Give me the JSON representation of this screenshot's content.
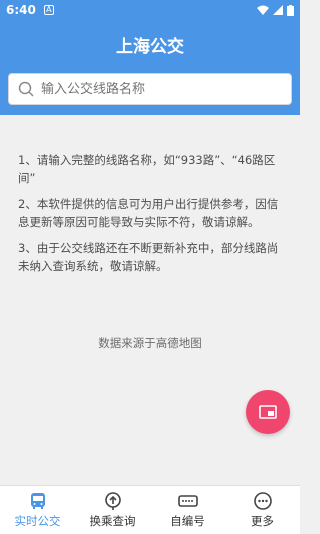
{
  "status_bar": {
    "time": "6:40",
    "notification_icon": "A"
  },
  "header": {
    "title": "上海公交"
  },
  "search": {
    "placeholder": "输入公交线路名称"
  },
  "notes": [
    "1、请输入完整的线路名称，如“933路”、“46路区间”",
    "2、本软件提供的信息可为用户出行提供参考，因信息更新等原因可能导致与实际不符，敬请谅解。",
    "3、由于公交线路还在不断更新补充中，部分线路尚未纳入查询系统，敬请谅解。"
  ],
  "source": "数据来源于高德地图",
  "tabs": [
    {
      "label": "实时公交",
      "icon": "bus-icon",
      "active": true
    },
    {
      "label": "换乘查询",
      "icon": "route-icon",
      "active": false
    },
    {
      "label": "自编号",
      "icon": "card-icon",
      "active": false
    },
    {
      "label": "更多",
      "icon": "more-icon",
      "active": false
    }
  ],
  "colors": {
    "primary": "#4a95e5",
    "fab": "#f0466e",
    "background": "#f0f0f0"
  }
}
